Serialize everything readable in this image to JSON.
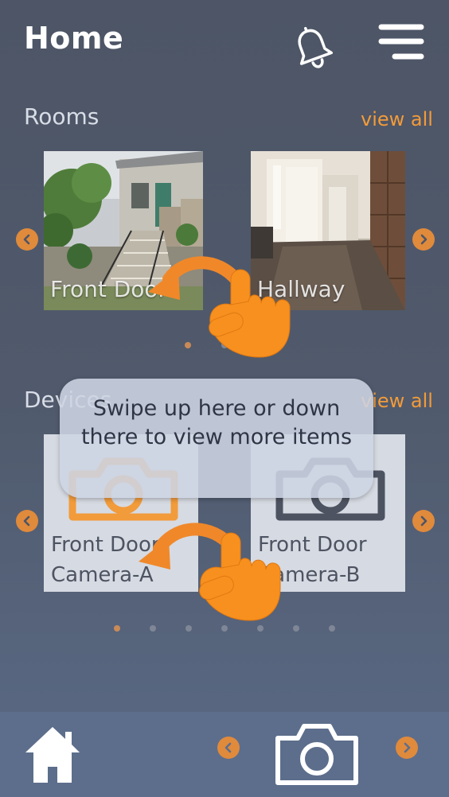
{
  "header": {
    "title": "Home",
    "bell_icon": "bell-icon",
    "menu_icon": "hamburger-menu-icon"
  },
  "rooms": {
    "title": "Rooms",
    "view_all": "view all",
    "items": [
      {
        "label": "Front Door"
      },
      {
        "label": "Hallway"
      }
    ],
    "page_count": 2,
    "active_page": 0
  },
  "devices": {
    "title": "Devices",
    "view_all": "view all",
    "items": [
      {
        "label_line1": "Front Door",
        "label_line2": "Camera-A",
        "icon_color": "#f29b3a"
      },
      {
        "label_line1": "Front Door",
        "label_line2": "Camera-B",
        "icon_color": "#4e5362"
      }
    ],
    "page_count": 7,
    "active_page": 0
  },
  "tooltip": {
    "text": "Swipe up here or down there to view more items"
  },
  "bottom_bar": {
    "home_icon": "home-icon",
    "camera_icon": "camera-icon"
  },
  "colors": {
    "accent": "#f29b3a",
    "background": "#4d5566",
    "bottom_bar": "#5d6e8c"
  }
}
